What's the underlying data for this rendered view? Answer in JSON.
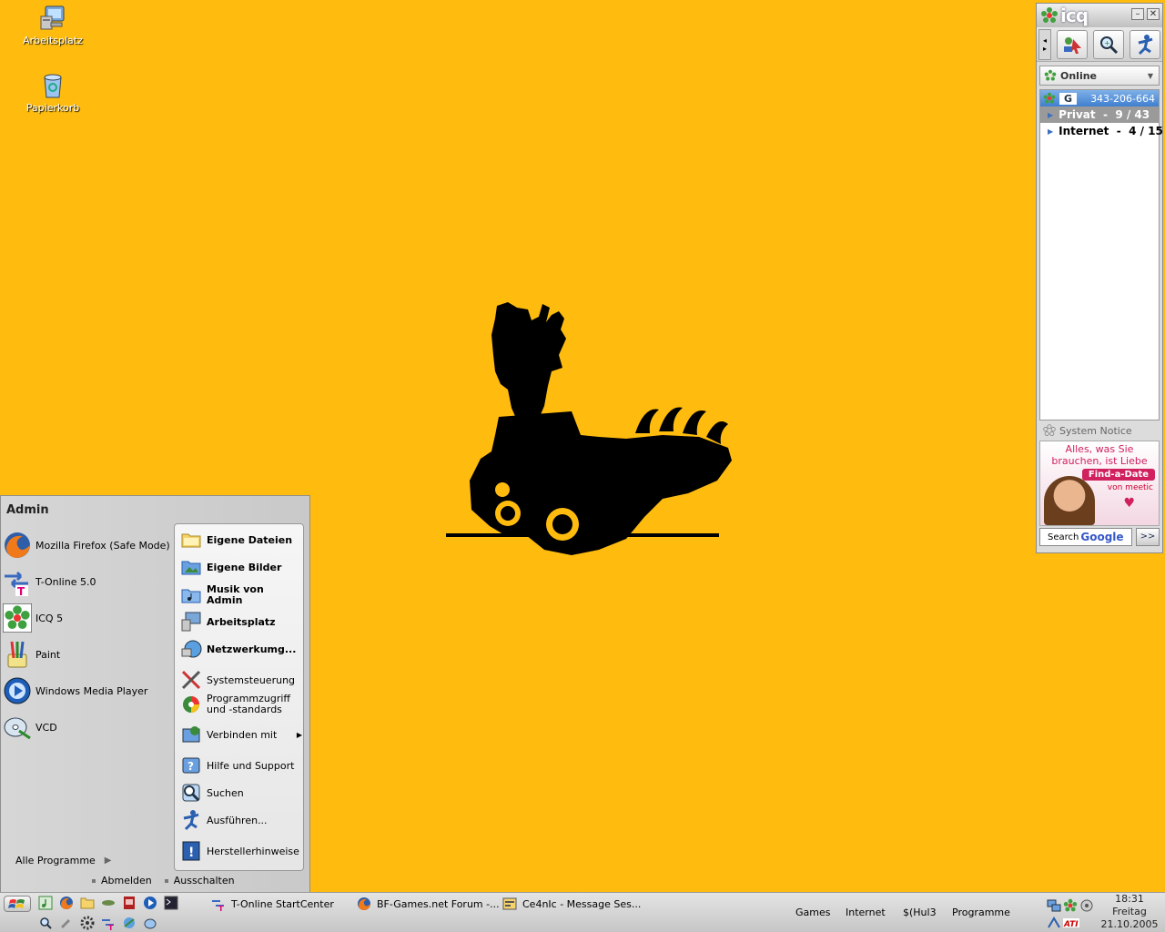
{
  "desktop": {
    "icons": [
      {
        "label": "Arbeitsplatz",
        "icon": "computer-icon"
      },
      {
        "label": "Papierkorb",
        "icon": "recycle-bin-icon"
      }
    ]
  },
  "icq": {
    "brand": "icq",
    "status": "Online",
    "account_badge": "G",
    "account_number": "343-206-664",
    "groups": [
      {
        "label": "Privat  -  9 / 43"
      },
      {
        "label": "Internet  -  4 / 15"
      }
    ],
    "system_notice": "System Notice",
    "ad": {
      "line1": "Alles, was Sie",
      "line2": "brauchen, ist Liebe",
      "button": "Find-a-Date",
      "brand": "von meetic"
    },
    "search_label": "Search",
    "search_brand": "Google",
    "search_go": ">>"
  },
  "startmenu": {
    "user": "Admin",
    "pinned": [
      {
        "label": "Mozilla Firefox (Safe Mode)"
      },
      {
        "label": "T-Online 5.0"
      },
      {
        "label": "ICQ 5"
      },
      {
        "label": "Paint"
      },
      {
        "label": "Windows Media Player"
      },
      {
        "label": "VCD"
      }
    ],
    "all_programs": "Alle Programme",
    "right": {
      "eigene_dateien": "Eigene Dateien",
      "eigene_bilder": "Eigene Bilder",
      "musik_1": "Musik von",
      "musik_2": "Admin",
      "arbeitsplatz": "Arbeitsplatz",
      "netzwerk": "Netzwerkumg...",
      "systemsteuerung": "Systemsteuerung",
      "programmzugriff_1": "Programmzugriff",
      "programmzugriff_2": "und -standards",
      "verbinden": "Verbinden mit",
      "hilfe": "Hilfe und Support",
      "suchen": "Suchen",
      "ausfuehren": "Ausführen...",
      "hersteller": "Herstellerhinweise"
    },
    "logoff": "Abmelden",
    "shutdown": "Ausschalten"
  },
  "taskbar": {
    "tasks": [
      {
        "label": "T-Online StartCenter"
      },
      {
        "label": "BF-Games.net Forum -..."
      },
      {
        "label": "Ce4nIc - Message Ses..."
      }
    ],
    "links": [
      "Games",
      "Internet",
      "$(Hul3",
      "Programme"
    ],
    "clock": {
      "time": "18:31",
      "day": "Freitag",
      "date": "21.10.2005"
    }
  },
  "colors": {
    "desktop": "#FFBC0E",
    "icq_selection": "#3f7fd0",
    "ad_pink": "#d0205d"
  }
}
